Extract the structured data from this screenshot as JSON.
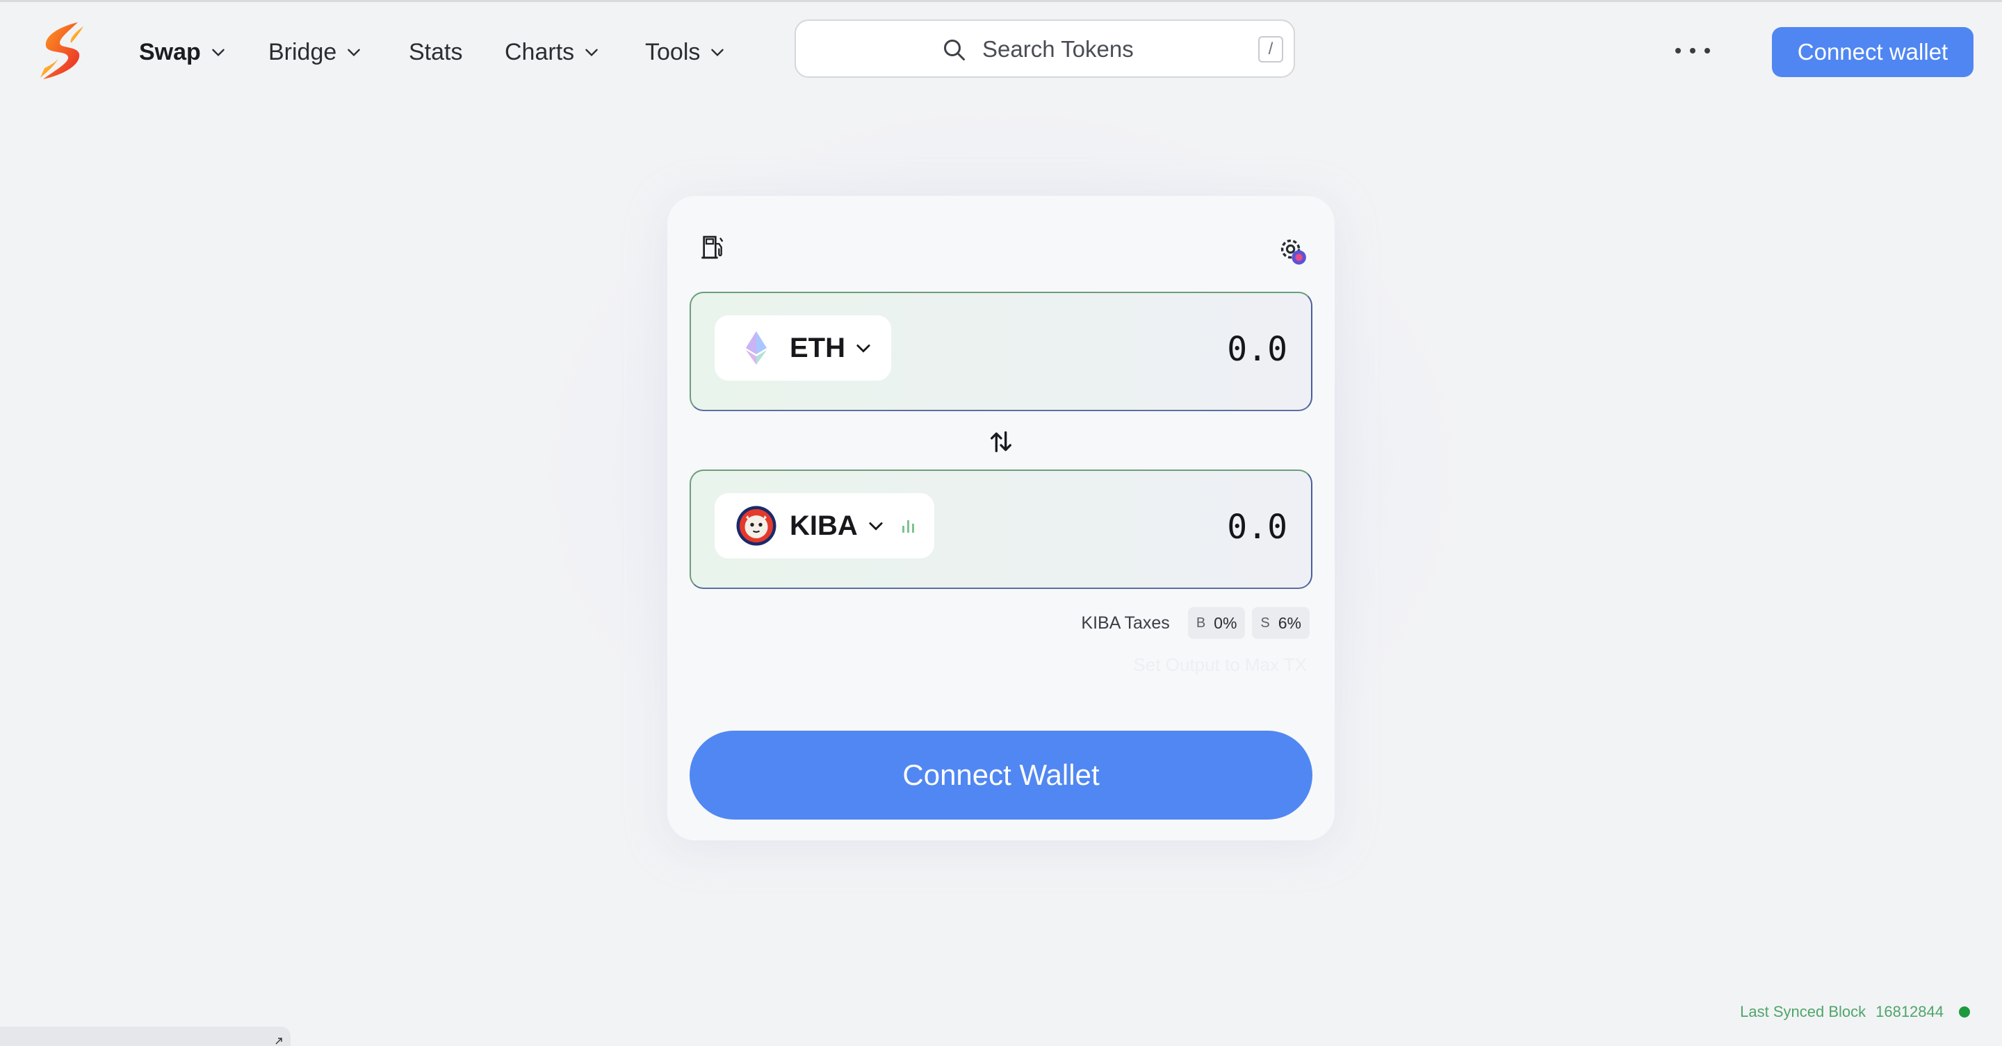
{
  "nav": {
    "items": [
      {
        "label": "Swap",
        "has_chevron": true,
        "active": true
      },
      {
        "label": "Bridge",
        "has_chevron": true
      },
      {
        "label": "Stats",
        "has_chevron": false
      },
      {
        "label": "Charts",
        "has_chevron": true
      },
      {
        "label": "Tools",
        "has_chevron": true
      }
    ],
    "search": {
      "placeholder": "Search Tokens",
      "shortcut": "/"
    },
    "more_icon": "ellipsis-icon",
    "connect_label": "Connect wallet"
  },
  "swap": {
    "gas_icon": "gas-pump-icon",
    "settings_icon": "gear-icon",
    "input": {
      "token": "ETH",
      "amount_placeholder": "0.0",
      "icon": "ethereum-icon"
    },
    "output": {
      "token": "KIBA",
      "amount_placeholder": "0.0",
      "icon": "kiba-token-icon",
      "chart_icon": "bar-chart-icon"
    },
    "switch_icon": "swap-arrows-icon",
    "taxes": {
      "label": "KIBA Taxes",
      "buy_key": "B",
      "buy_value": "0%",
      "sell_key": "S",
      "sell_value": "6%"
    },
    "max_tx_label": "Set Output to Max TX",
    "connect_label": "Connect Wallet"
  },
  "footer": {
    "synced_label": "Last Synced Block",
    "block_number": "16812844"
  },
  "colors": {
    "accent": "#5187f2",
    "status_green": "#1e9a3e",
    "synced_text": "#4fa56a"
  }
}
